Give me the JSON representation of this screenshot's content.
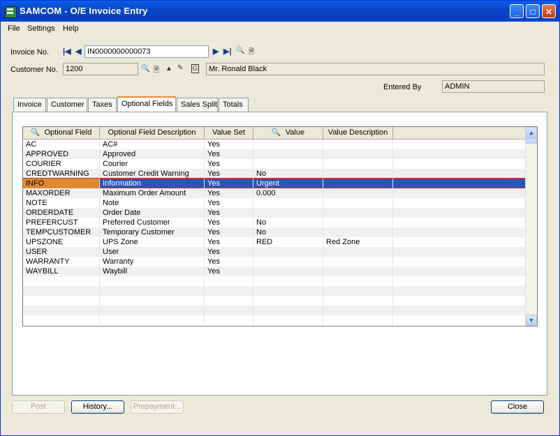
{
  "window": {
    "title": "SAMCOM - O/E Invoice Entry",
    "minimize": "_",
    "maximize": "□",
    "close": "✕"
  },
  "menu": [
    "File",
    "Settings",
    "Help"
  ],
  "header": {
    "invoice_label": "Invoice No.",
    "invoice_value": "IN0000000000073",
    "customer_label": "Customer No.",
    "customer_value": "1200",
    "customer_name": "Mr. Ronald Black",
    "entered_by_label": "Entered By",
    "entered_by_value": "ADMIN"
  },
  "tabs": [
    {
      "label": "Invoice",
      "active": false
    },
    {
      "label": "Customer",
      "active": false
    },
    {
      "label": "Taxes",
      "active": false
    },
    {
      "label": "Optional Fields",
      "active": true
    },
    {
      "label": "Sales Split",
      "active": false
    },
    {
      "label": "Totals",
      "active": false
    }
  ],
  "grid": {
    "columns": [
      "Optional Field",
      "Optional Field Description",
      "Value Set",
      "Value",
      "Value Description"
    ],
    "rows": [
      [
        "AC",
        "AC#",
        "Yes",
        "",
        ""
      ],
      [
        "APPROVED",
        "Approved",
        "Yes",
        "",
        ""
      ],
      [
        "COURIER",
        "Courier",
        "Yes",
        "",
        ""
      ],
      [
        "CREDTWARNING",
        "Customer Credit Warning",
        "Yes",
        "No",
        ""
      ],
      [
        "INFO",
        "Information",
        "Yes",
        "Urgent",
        ""
      ],
      [
        "MAXORDER",
        "Maximum Order Amount",
        "Yes",
        "0.000",
        ""
      ],
      [
        "NOTE",
        "Note",
        "Yes",
        "",
        ""
      ],
      [
        "ORDERDATE",
        "Order Date",
        "Yes",
        "",
        ""
      ],
      [
        "PREFERCUST",
        "Preferred Customer",
        "Yes",
        "No",
        ""
      ],
      [
        "TEMPCUSTOMER",
        "Temporary Customer",
        "Yes",
        "No",
        ""
      ],
      [
        "UPSZONE",
        "UPS Zone",
        "Yes",
        "RED",
        "Red Zone"
      ],
      [
        "USER",
        "User",
        "Yes",
        "",
        ""
      ],
      [
        "WARRANTY",
        "Warranty",
        "Yes",
        "",
        ""
      ],
      [
        "WAYBILL",
        "Waybill",
        "Yes",
        "",
        ""
      ]
    ],
    "selected_row": 4
  },
  "buttons": {
    "post": "Post",
    "history": "History...",
    "prepayment": "Prepayment...",
    "close": "Close"
  },
  "colors": {
    "selection": "#2c54b8",
    "selected_key_cell": "#e08a30",
    "titlebar": "#0a3fbf"
  }
}
